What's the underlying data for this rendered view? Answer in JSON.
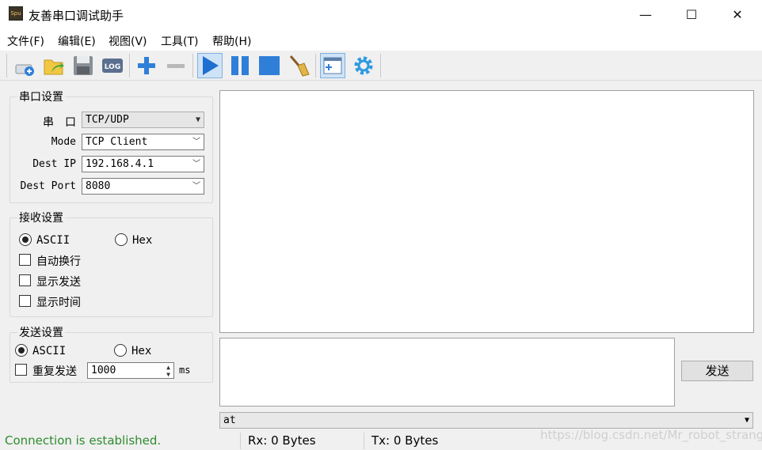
{
  "window": {
    "icon_text": "Spu",
    "title": "友善串口调试助手",
    "minimize": "—",
    "maximize": "☐",
    "close": "✕"
  },
  "menu": {
    "items": [
      {
        "label": "文件(F)"
      },
      {
        "label": "编辑(E)"
      },
      {
        "label": "视图(V)"
      },
      {
        "label": "工具(T)"
      },
      {
        "label": "帮助(H)"
      }
    ]
  },
  "toolbar": {
    "icons": [
      "new-session-icon",
      "open-folder-icon",
      "save-icon",
      "log-icon",
      "add-icon",
      "remove-icon",
      "start-icon",
      "pause-icon",
      "stop-icon",
      "clear-broom-icon",
      "layout-icon",
      "settings-gear-icon"
    ],
    "log_text": "LOG"
  },
  "serial_settings": {
    "title": "串口设置",
    "port_label": "串　口",
    "port_value": "TCP/UDP",
    "mode_label": "Mode",
    "mode_value": "TCP Client",
    "dest_ip_label": "Dest IP",
    "dest_ip_value": "192.168.4.1",
    "dest_port_label": "Dest Port",
    "dest_port_value": "8080"
  },
  "receive_settings": {
    "title": "接收设置",
    "ascii_label": "ASCII",
    "hex_label": "Hex",
    "selected": "ASCII",
    "auto_wrap": "自动换行",
    "show_send": "显示发送",
    "show_time": "显示时间"
  },
  "send_settings": {
    "title": "发送设置",
    "ascii_label": "ASCII",
    "hex_label": "Hex",
    "selected": "ASCII",
    "repeat_label": "重复发送",
    "interval_value": "1000",
    "interval_unit": "ms"
  },
  "send": {
    "button_label": "发送",
    "command_value": "at"
  },
  "status": {
    "connection": "Connection is established.",
    "rx": "Rx: 0 Bytes",
    "tx": "Tx: 0 Bytes",
    "watermark": "https://blog.csdn.net/Mr_robot_strange"
  },
  "colors": {
    "status_green": "#2e8b2e",
    "accent_blue": "#2f7fd8"
  }
}
